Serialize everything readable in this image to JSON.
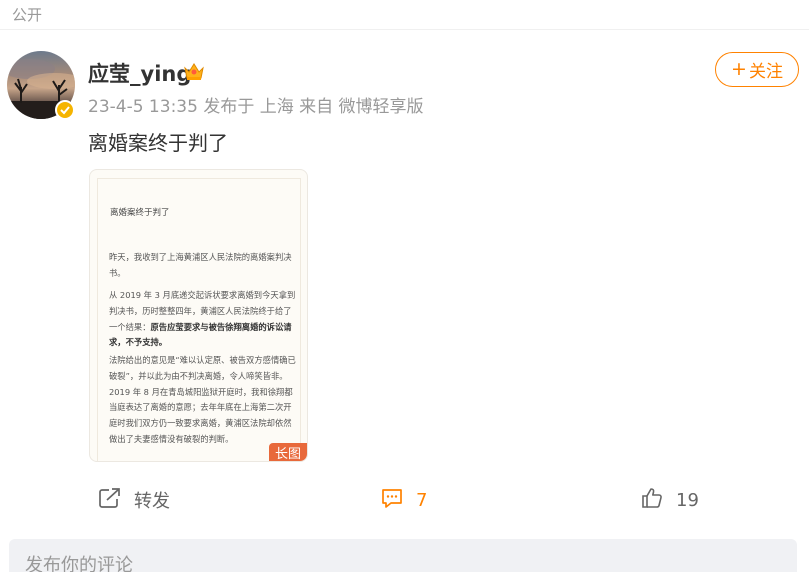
{
  "header": {
    "visibility_label": "公开"
  },
  "post": {
    "author": "应莹_ying",
    "author_badge_icon": "crown-icon",
    "verified_icon": "verified-check-icon",
    "meta": "23-4-5 13:35  发布于 上海  来自 微博轻享版",
    "follow_label": "关注",
    "follow_plus": "+",
    "text": "离婚案终于判了",
    "long_image": {
      "title": "离婚案终于判了",
      "p1": "昨天，我收到了上海黄浦区人民法院的离婚案判决书。",
      "p2_a": "从 2019 年 3 月底递交起诉状要求离婚到今天拿到判决书，历时整整四年，黄浦区人民法院终于给了一个结果：",
      "p2_b": "原告应莹要求与被告徐翔离婚的诉讼请求，不予支持。",
      "p3": "法院给出的意见是“难以认定原、被告双方感情确已破裂”，并以此为由不判决离婚，令人啼笑皆非。2019 年 8 月在青岛城阳监狱开庭时，我和徐翔都当庭表达了离婚的意愿；去年年底在上海第二次开庭时我们双方仍一致要求离婚，黄浦区法院却依然做出了夫妻感情没有破裂的判断。",
      "badge": "长图"
    }
  },
  "actions": {
    "repost": {
      "icon": "share-icon",
      "label": "转发"
    },
    "comment": {
      "icon": "comment-icon",
      "count": "7"
    },
    "like": {
      "icon": "thumbs-up-icon",
      "count": "19"
    }
  },
  "comment_input": {
    "placeholder": "发布你的评论"
  },
  "colors": {
    "accent": "#ff8200",
    "muted": "#999999",
    "badge": "#e8693b"
  }
}
